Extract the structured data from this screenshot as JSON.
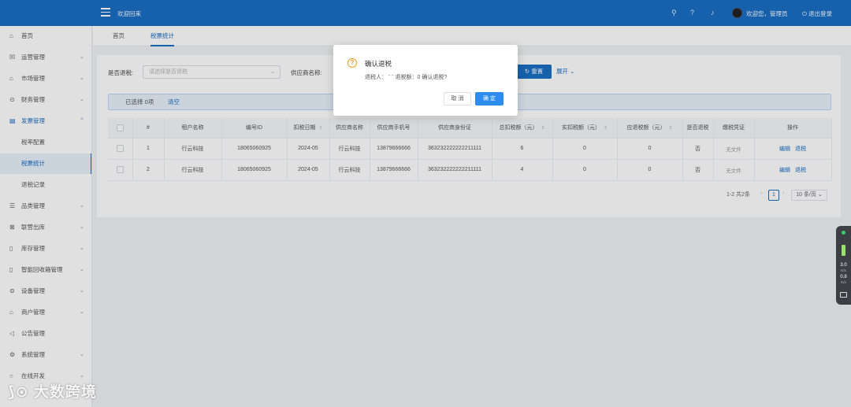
{
  "header": {
    "welcome": "欢迎回来",
    "user": "欢迎您，管理员",
    "logout": "退出登录",
    "icons": [
      "search-icon",
      "help-icon",
      "bell-icon"
    ]
  },
  "sidebar": {
    "items": [
      {
        "label": "首页",
        "icon": "⌂"
      },
      {
        "label": "运营管理",
        "icon": "☒",
        "chev": "⌄"
      },
      {
        "label": "市场管理",
        "icon": "⌂",
        "chev": "⌄"
      },
      {
        "label": "财务管理",
        "icon": "⊙",
        "chev": "⌄"
      },
      {
        "label": "发票管理",
        "icon": "▤",
        "chev": "⌃"
      },
      {
        "label": "税率配置"
      },
      {
        "label": "税票统计"
      },
      {
        "label": "退税记录"
      },
      {
        "label": "品类管理",
        "icon": "☰",
        "chev": "⌄"
      },
      {
        "label": "联营出库",
        "icon": "⊠",
        "chev": "⌄"
      },
      {
        "label": "库存管理",
        "icon": "▯",
        "chev": "⌄"
      },
      {
        "label": "智能回收箱管理",
        "icon": "▯",
        "chev": "⌄"
      },
      {
        "label": "设备管理",
        "icon": "⊜",
        "chev": "⌄"
      },
      {
        "label": "商户管理",
        "icon": "⌂",
        "chev": "⌄"
      },
      {
        "label": "公告管理",
        "icon": "◁",
        "chev": ""
      },
      {
        "label": "系统管理",
        "icon": "⚙",
        "chev": "⌄"
      },
      {
        "label": "在线开发",
        "icon": "○",
        "chev": "⌄"
      }
    ]
  },
  "tabs": [
    "首页",
    "税票统计"
  ],
  "filters": {
    "refund_label": "是否退税:",
    "refund_placeholder": "请选择是否退税",
    "supplier_label": "供应商名称:",
    "reset": "重置",
    "expand": "展开"
  },
  "selection": {
    "count": "已选择 0项",
    "clear": "清空"
  },
  "table": {
    "columns": [
      "#",
      "租户名称",
      "编号ID",
      "扣税日期",
      "供应商名称",
      "供应商手机号",
      "供应商身份证",
      "总扣税额（元）",
      "实扣税额（元）",
      "应退税额（元）",
      "是否退税",
      "缴税凭证",
      "操作"
    ],
    "rows": [
      {
        "idx": "1",
        "tenant": "行云科技",
        "id": "18065060925",
        "date": "2024-05",
        "supplier": "行云科技",
        "phone": "13879666666",
        "idcard": "363232222222211111",
        "total": "6",
        "actual": "0",
        "refund": "0",
        "refunded": "否",
        "voucher": "无文件",
        "edit": "编辑",
        "action": "退税"
      },
      {
        "idx": "2",
        "tenant": "行云科技",
        "id": "18065060925",
        "date": "2024-05",
        "supplier": "行云科技",
        "phone": "13879666666",
        "idcard": "363232222222211111",
        "total": "4",
        "actual": "0",
        "refund": "0",
        "refunded": "否",
        "voucher": "无文件",
        "edit": "编辑",
        "action": "退税"
      }
    ]
  },
  "pagination": {
    "summary": "1-2 共2条",
    "current": "1",
    "page_size": "10 条/页"
  },
  "dialog": {
    "title": "确认退税",
    "message": "退税人：  ˉ ˉ 退税额：0 确认退税?",
    "cancel": "取 消",
    "ok": "确 定"
  },
  "widget": {
    "up": "3.0",
    "up_unit": "K/s",
    "down": "0.8",
    "down_unit": "K/s"
  },
  "watermark": "大数跨境",
  "colors": {
    "primary": "#1a6ec4",
    "warning": "#f0a020"
  }
}
